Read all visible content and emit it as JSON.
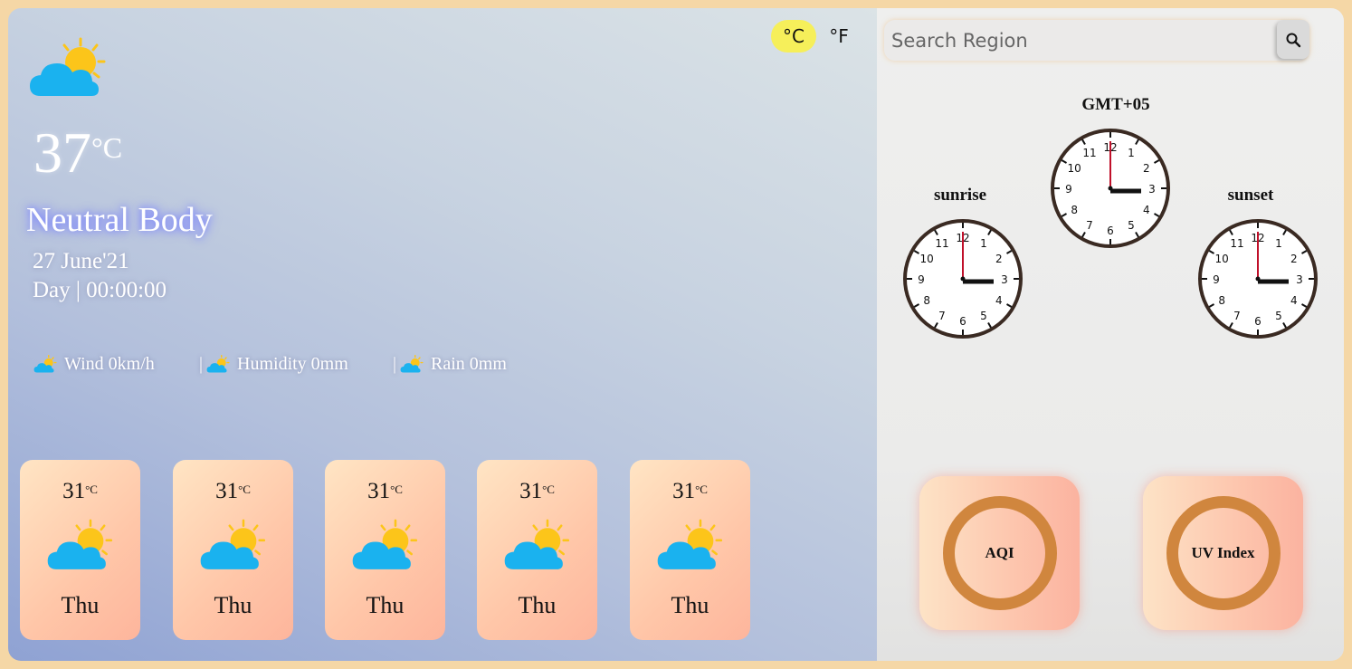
{
  "current": {
    "temp": "37",
    "unit": "°C",
    "condition": "Neutral Body",
    "date": "27 June'21",
    "time": "Day | 00:00:00",
    "icon": "partly-cloudy-icon"
  },
  "stats": {
    "wind": "Wind 0km/h",
    "humidity": "Humidity 0mm",
    "rain": "Rain 0mm",
    "separator": "|"
  },
  "forecast": [
    {
      "temp": "31",
      "unit": "°C",
      "day": "Thu"
    },
    {
      "temp": "31",
      "unit": "°C",
      "day": "Thu"
    },
    {
      "temp": "31",
      "unit": "°C",
      "day": "Thu"
    },
    {
      "temp": "31",
      "unit": "°C",
      "day": "Thu"
    },
    {
      "temp": "31",
      "unit": "°C",
      "day": "Thu"
    }
  ],
  "units": {
    "celsius": "°C",
    "fahrenheit": "°F",
    "selected": "celsius"
  },
  "search": {
    "placeholder": "Search Region"
  },
  "clocks": {
    "timezone": "GMT+05",
    "sunrise": "sunrise",
    "sunset": "sunset",
    "numbers": [
      "12",
      "1",
      "2",
      "3",
      "4",
      "5",
      "6",
      "7",
      "8",
      "9",
      "10",
      "11"
    ]
  },
  "gauges": {
    "aqi": "AQI",
    "uv": "UV Index"
  },
  "colors": {
    "accent_yellow": "#f6ef5a",
    "ring": "#d0863e",
    "cloud": "#1ab2ef",
    "sun": "#fcc51a",
    "clock_hand_red": "#c0102a"
  }
}
